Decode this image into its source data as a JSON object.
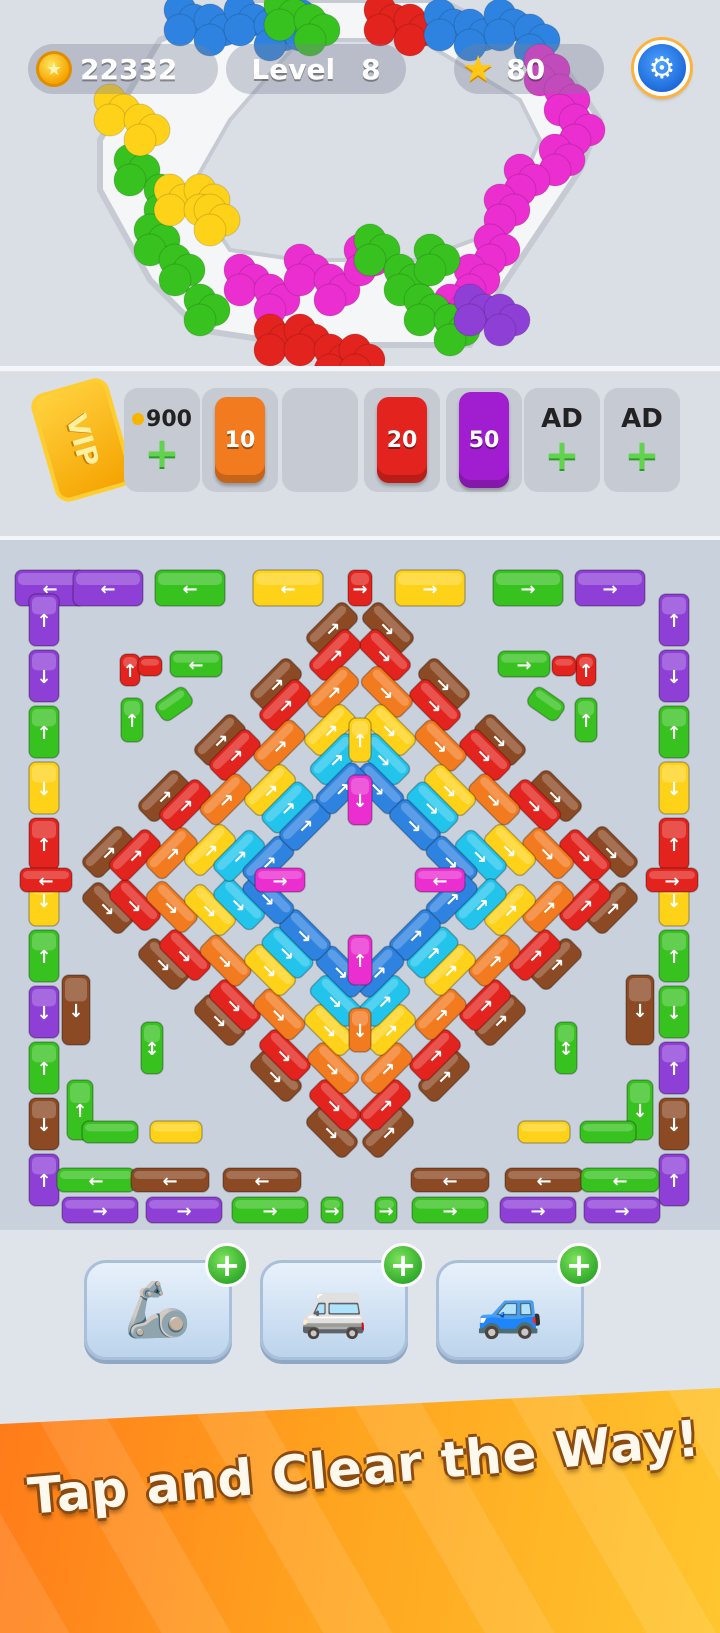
{
  "hud": {
    "coins": "22332",
    "level_label": "Level",
    "level_number": "8",
    "stars": "80"
  },
  "slots": [
    {
      "kind": "vip",
      "label": "VIP"
    },
    {
      "kind": "buy",
      "price": "900"
    },
    {
      "kind": "car",
      "number": "10",
      "color": "#f27a1f"
    },
    {
      "kind": "empty"
    },
    {
      "kind": "car",
      "number": "20",
      "color": "#e3231d"
    },
    {
      "kind": "car",
      "number": "50",
      "color": "#a11ed0"
    },
    {
      "kind": "ad",
      "label": "AD"
    },
    {
      "kind": "ad",
      "label": "AD"
    }
  ],
  "boosters": [
    {
      "name": "claw",
      "icon": "claw-icon"
    },
    {
      "name": "van",
      "icon": "van-icon"
    },
    {
      "name": "paint",
      "icon": "paint-car-icon"
    }
  ],
  "banner": {
    "tagline": "Tap and  Clear the Way!"
  },
  "colors": {
    "red": "#e3231d",
    "brown": "#8b4a24",
    "yellow": "#ffd21a",
    "cyan": "#22c4ec",
    "blue": "#2e83e0",
    "magenta": "#ea2ed0",
    "green": "#38c21f",
    "purple": "#8e3fd6",
    "orange": "#f27a1f"
  }
}
